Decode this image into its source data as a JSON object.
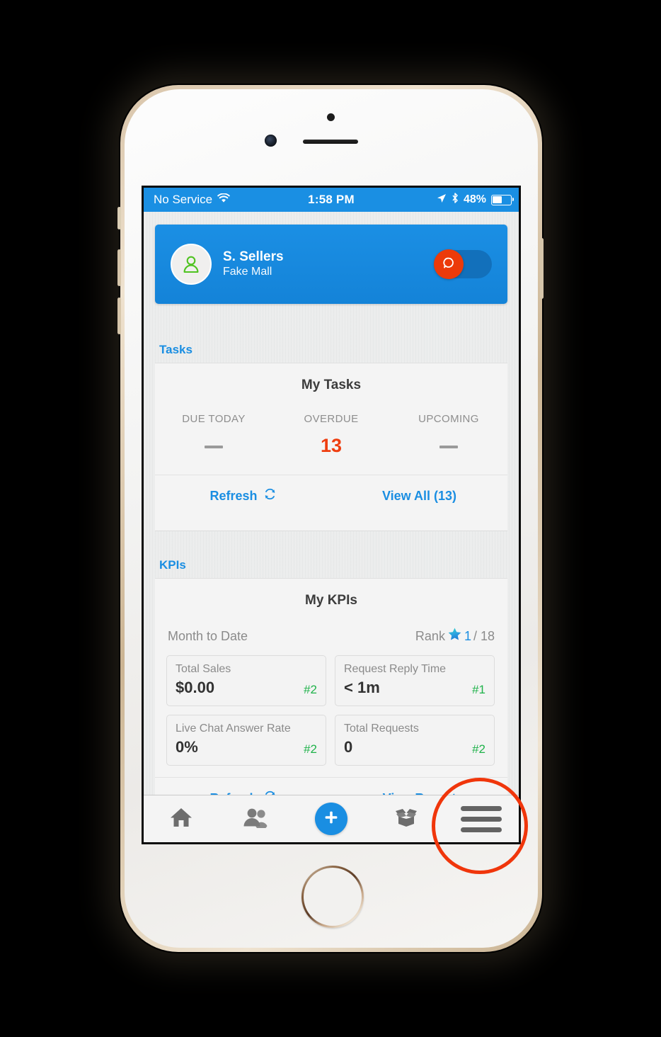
{
  "status_bar": {
    "carrier": "No Service",
    "wifi_icon": "wifi-icon",
    "time": "1:58 PM",
    "location_icon": "location-arrow-icon",
    "bluetooth_icon": "bluetooth-icon",
    "battery_percent": "48%",
    "battery_icon": "battery-icon"
  },
  "header": {
    "avatar_icon": "person-avatar-icon",
    "user_name": "S. Sellers",
    "org_name": "Fake Mall",
    "toggle": {
      "name": "chat-availability-toggle",
      "state": "off",
      "knob_icon": "chat-bubble-icon",
      "knob_color": "#ec3a0a",
      "track_color": "#1270bb"
    },
    "background_color": "#1b8fe4"
  },
  "sections": {
    "tasks_label": "Tasks",
    "kpis_label": "KPIs"
  },
  "tasks_card": {
    "title": "My Tasks",
    "stats": [
      {
        "label": "DUE TODAY",
        "value": "—",
        "is_dash": true,
        "color": "#9a9a9a"
      },
      {
        "label": "OVERDUE",
        "value": "13",
        "is_dash": false,
        "color": "#ee3e10"
      },
      {
        "label": "UPCOMING",
        "value": "—",
        "is_dash": true,
        "color": "#9a9a9a"
      }
    ],
    "refresh_label": "Refresh",
    "refresh_icon": "refresh-icon",
    "view_all_label": "View All (13)"
  },
  "kpis_card": {
    "title": "My KPIs",
    "period_label": "Month to Date",
    "rank_label": "Rank",
    "rank_icon": "star-icon",
    "rank_value": "1",
    "rank_total": "/ 18",
    "metrics": [
      {
        "name": "Total Sales",
        "value": "$0.00",
        "rank": "#2"
      },
      {
        "name": "Request Reply Time",
        "value": "< 1m",
        "rank": "#1"
      },
      {
        "name": "Live Chat Answer Rate",
        "value": "0%",
        "rank": "#2"
      },
      {
        "name": "Total Requests",
        "value": "0",
        "rank": "#2"
      }
    ],
    "refresh_label": "Refresh",
    "refresh_icon": "refresh-icon",
    "view_report_label": "View Report"
  },
  "tab_bar": {
    "items": [
      {
        "name": "tab-home",
        "icon": "home-icon"
      },
      {
        "name": "tab-contacts",
        "icon": "people-icon"
      },
      {
        "name": "tab-add",
        "icon": "plus-icon"
      },
      {
        "name": "tab-inventory",
        "icon": "open-box-icon"
      },
      {
        "name": "tab-menu",
        "icon": "hamburger-menu-icon"
      }
    ]
  },
  "annotation": {
    "name": "highlight-circle",
    "target": "tab-menu",
    "color": "#f0360b"
  },
  "theme": {
    "accent_blue": "#1a8ee2",
    "alert_orange": "#ee3e10",
    "rank_green": "#1fb24a",
    "screen_bg": "#eceded"
  }
}
